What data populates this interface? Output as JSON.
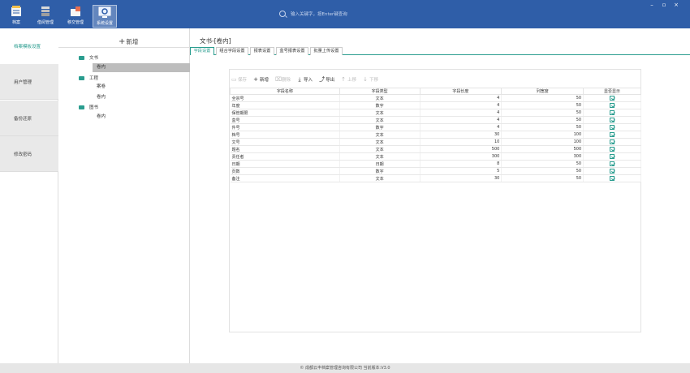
{
  "header": {
    "nav": [
      {
        "label": "档案",
        "icon": "archive-icon"
      },
      {
        "label": "借阅管理",
        "icon": "borrow-icon"
      },
      {
        "label": "移交管理",
        "icon": "transfer-icon"
      },
      {
        "label": "系统设置",
        "icon": "settings-icon"
      }
    ],
    "search_placeholder": "输入关键字，按Enter键查询",
    "window_controls": {
      "minimize": "–",
      "restore": "▫",
      "close": "×"
    }
  },
  "leftnav": {
    "items": [
      {
        "label": "档案模板设置",
        "active": true
      },
      {
        "label": "用户管理",
        "active": false
      },
      {
        "label": "备份还原",
        "active": false
      },
      {
        "label": "修改密码",
        "active": false
      }
    ]
  },
  "tree": {
    "add_label": "新增",
    "categories": [
      {
        "label": "文书",
        "children": [
          "卷内"
        ]
      },
      {
        "label": "工程",
        "children": [
          "案卷",
          "卷内"
        ]
      },
      {
        "label": "图书",
        "children": [
          "卷内"
        ]
      }
    ]
  },
  "main": {
    "title": "文书-[卷内]",
    "tabs": [
      "字段设置",
      "组合字段设置",
      "报表设置",
      "盒号报表设置",
      "批量上传设置"
    ],
    "toolbar": {
      "save": "保存",
      "add": "新增",
      "delete": "删除",
      "import": "导入",
      "export": "导出",
      "up": "上移",
      "down": "下移"
    },
    "table": {
      "headers": [
        "字段名称",
        "字段类型",
        "字段长度",
        "列宽度",
        "显否显示"
      ],
      "rows": [
        {
          "name": "全宗号",
          "type": "文本",
          "length": "4",
          "width": "50"
        },
        {
          "name": "年度",
          "type": "数字",
          "length": "4",
          "width": "50"
        },
        {
          "name": "保管期限",
          "type": "文本",
          "length": "4",
          "width": "50"
        },
        {
          "name": "盒号",
          "type": "文本",
          "length": "4",
          "width": "50"
        },
        {
          "name": "件号",
          "type": "数字",
          "length": "4",
          "width": "50"
        },
        {
          "name": "档号",
          "type": "文本",
          "length": "30",
          "width": "100"
        },
        {
          "name": "文号",
          "type": "文本",
          "length": "10",
          "width": "100"
        },
        {
          "name": "题名",
          "type": "文本",
          "length": "500",
          "width": "500"
        },
        {
          "name": "责任者",
          "type": "文本",
          "length": "300",
          "width": "300"
        },
        {
          "name": "日期",
          "type": "日期",
          "length": "8",
          "width": "50"
        },
        {
          "name": "页数",
          "type": "数字",
          "length": "5",
          "width": "50"
        },
        {
          "name": "备注",
          "type": "文本",
          "length": "30",
          "width": "50"
        }
      ]
    }
  },
  "footer": {
    "text": "© 成都云丰档案管理咨询有限公司   当前版本:V3.0"
  },
  "colors": {
    "brand": "#2f5ea8",
    "accent": "#2a9d8f"
  }
}
